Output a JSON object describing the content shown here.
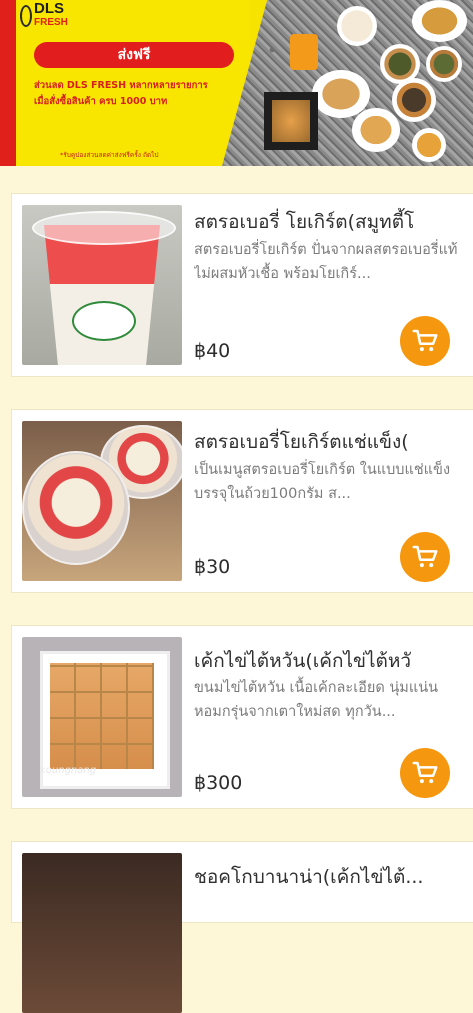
{
  "banner": {
    "logo_main": "DLS",
    "logo_sub": "FRESH",
    "pill": "ส่งฟรี",
    "promo_line1": "ส่วนลด DLS FRESH หลากหลายรายการ",
    "promo_line2": "เมื่อสั่งซื้อสินค้า ครบ 1000 บาท",
    "fine_print": "*รับคูปองส่วนลดค่าส่งฟรีครั้ง ถัดไป"
  },
  "products": [
    {
      "title": "สตรอเบอรี่ โยเกิร์ต(สมูทตี้โ",
      "desc": "สตรอเบอรี่โยเกิร์ต ปั่นจากผลสตรอเบอรี่แท้ไม่ผสมหัวเชื้อ พร้อมโยเกิร์...",
      "price": "฿40"
    },
    {
      "title": "สตรอเบอรี่โยเกิร์ตแช่แข็ง(",
      "desc": "เป็นเมนูสตรอเบอรี่โยเกิร์ต ในแบบแช่แข็ง บรรจุในถ้วย100กรัม ส...",
      "price": "฿30"
    },
    {
      "title": "เค้กไข่ไต้หวัน(เค้กไข่ไต้หวั",
      "desc": "ขนมไข่ไต้หวัน เนื้อเค้กละเอียด นุ่มแน่น หอมกรุ่นจากเตาใหม่สด ทุกวัน...",
      "price": "฿300",
      "watermark": "koungnang"
    },
    {
      "title": "ชอคโกบานาน่า(เค้กไข่ไต้..."
    }
  ],
  "icons": {
    "cart": "cart-icon"
  },
  "colors": {
    "accent": "#f5980f",
    "banner_yellow": "#f9e600",
    "banner_red": "#e21d1d"
  }
}
